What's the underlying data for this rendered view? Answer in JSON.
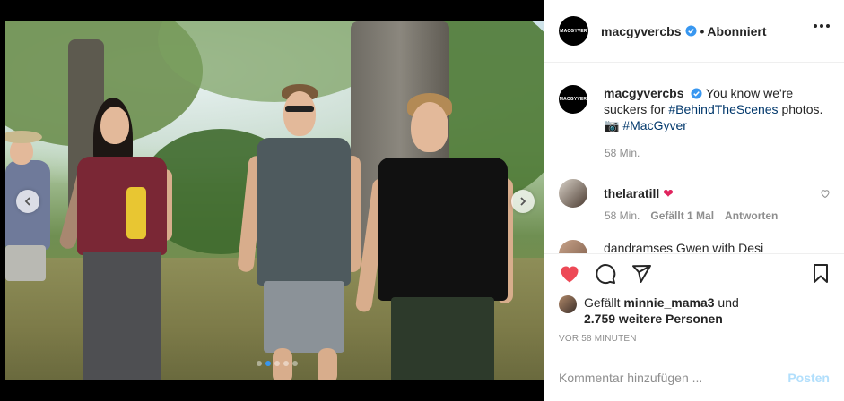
{
  "post": {
    "account": {
      "username": "macgyvercbs",
      "avatar_text": "MACGYVER",
      "verified": true,
      "separator": "•",
      "follow_status": "Abonniert"
    },
    "caption": {
      "username": "macgyvercbs",
      "text_before": " You know we're suckers for ",
      "hashtag1": "#BehindTheScenes",
      "text_mid": " photos.",
      "emoji": "📷",
      "hashtag2": "#MacGyver",
      "time": "58 Min."
    },
    "comment": {
      "username": "thelaratill",
      "emoji": "❤",
      "time": "58 Min.",
      "likes": "Gefällt 1 Mal",
      "reply": "Antworten"
    },
    "next_comment_partial": "dandramses Gwen with Desi",
    "likes": {
      "prefix": "Gefällt ",
      "user": "minnie_mama3",
      "connector": " und",
      "others": "2.759 weitere Personen"
    },
    "timestamp": "VOR 58 MINUTEN",
    "comment_box": {
      "placeholder": "Kommentar hinzufügen ...",
      "post_label": "Posten"
    },
    "carousel": {
      "slides": 5,
      "active": 1
    }
  },
  "colors": {
    "like_red": "#ed4956",
    "link_blue": "#00376b",
    "verified_blue": "#3897f0",
    "post_disabled": "#b2dffc",
    "meta_gray": "#8e8e8e"
  },
  "icons": [
    "chevron-left-icon",
    "chevron-right-icon",
    "verified-badge-icon",
    "more-icon",
    "heart-icon",
    "comment-icon",
    "share-icon",
    "bookmark-icon",
    "camera-emoji"
  ]
}
